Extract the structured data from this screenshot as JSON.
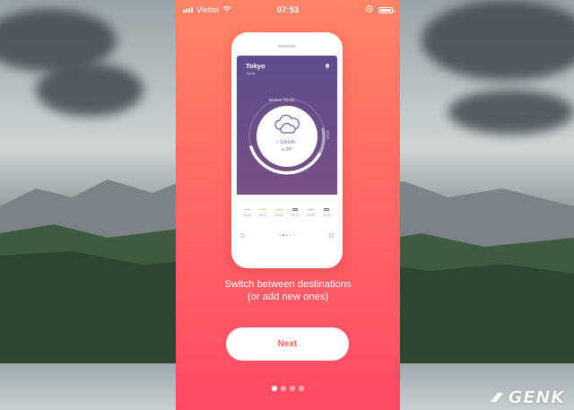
{
  "status_bar": {
    "carrier": "Viettel",
    "time": "07:53"
  },
  "app_card": {
    "city": "Tokyo",
    "country": "Japan",
    "condition": "Broken clouds",
    "wind": "11Km/h",
    "temperature": "24°",
    "sunset": "20:09",
    "forecast": [
      {
        "time": "04:16",
        "icon": "line"
      },
      {
        "time": "04:27",
        "icon": "sun-line"
      },
      {
        "time": "05:21",
        "icon": "sun-line"
      },
      {
        "time": "16:15",
        "icon": "cloud-icon"
      },
      {
        "time": "19:09",
        "icon": "line"
      },
      {
        "time": "19:33",
        "icon": "cloud-icon"
      }
    ]
  },
  "onboarding": {
    "caption_line1": "Switch between destinations",
    "caption_line2": "(or add new ones)",
    "next_label": "Next",
    "page_count": 4,
    "current_page": 1
  },
  "watermark": {
    "text": "GENK"
  },
  "colors": {
    "accent": "#ff5d5e",
    "card_purple": "#5d4d8d"
  }
}
